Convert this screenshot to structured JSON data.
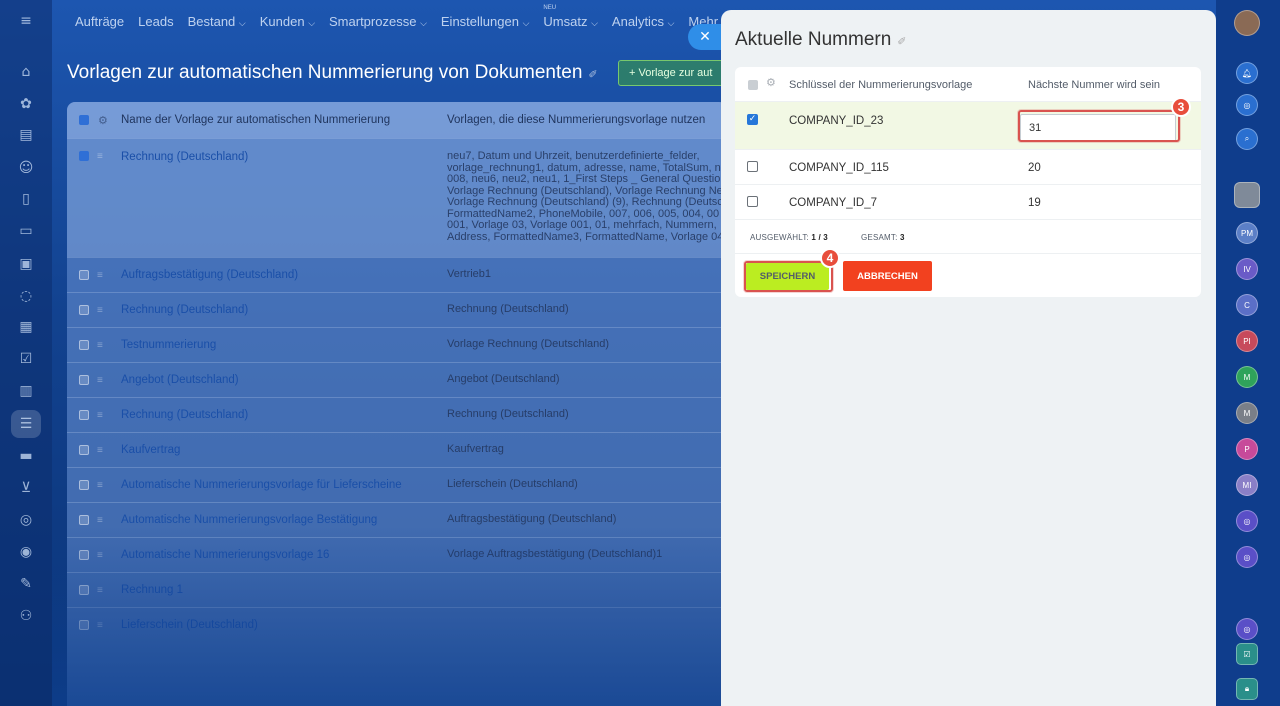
{
  "topnav": {
    "items": [
      "Aufträge",
      "Leads",
      "Bestand",
      "Kunden",
      "Smartprozesse",
      "Einstellungen",
      "Umsatz",
      "Analytics",
      "Mehr"
    ],
    "dropdown_marker": "⌵",
    "new_badge": "NEU"
  },
  "page": {
    "title": "Vorlagen zur automatischen Nummerierung von Dokumenten",
    "add_button": "+ Vorlage zur aut"
  },
  "bg_table": {
    "headers": [
      "Name der Vorlage zur automatischen Nummerierung",
      "Vorlagen, die diese Nummerierungsvorlage nutzen"
    ],
    "rows": [
      {
        "name": "Rechnung (Deutschland)",
        "templates": "neu7, Datum und Uhrzeit, benutzerdefinierte_felder,\nvorlage_rechnung1, datum, adresse, name, TotalSum, ne\n008, neu6, neu2, neu1, 1_First Steps _ General Questio\nVorlage Rechnung (Deutschland), Vorlage Rechnung Ne\nVorlage Rechnung (Deutschland) (9), Rechnung (Deutsc\nFormattedName2, PhoneMobile, 007, 006, 005, 004, 00\n001, Vorlage 03, Vorlage 001, 01, mehrfach, Nummern,\nAddress, FormattedName3, FormattedName, Vorlage 04"
      },
      {
        "name": "Auftragsbestätigung (Deutschland)",
        "templates": "Vertrieb1"
      },
      {
        "name": "Rechnung (Deutschland)",
        "templates": "Rechnung (Deutschland)"
      },
      {
        "name": "Testnummerierung",
        "templates": "Vorlage Rechnung (Deutschland)"
      },
      {
        "name": "Angebot (Deutschland)",
        "templates": "Angebot (Deutschland)"
      },
      {
        "name": "Rechnung (Deutschland)",
        "templates": "Rechnung (Deutschland)"
      },
      {
        "name": "Kaufvertrag",
        "templates": "Kaufvertrag"
      },
      {
        "name": "Automatische Nummerierungsvorlage für Lieferscheine",
        "templates": "Lieferschein (Deutschland)"
      },
      {
        "name": "Automatische Nummerierungsvorlage Bestätigung",
        "templates": "Auftragsbestätigung (Deutschland)"
      },
      {
        "name": "Automatische Nummerierungsvorlage 16",
        "templates": "Vorlage Auftragsbestätigung (Deutschland)1"
      },
      {
        "name": "Rechnung 1",
        "templates": ""
      },
      {
        "name": "Lieferschein (Deutschland)",
        "templates": ""
      }
    ]
  },
  "panel": {
    "close_glyph": "✕",
    "title": "Aktuelle Nummern",
    "col_key": "Schlüssel der Nummerierungsvorlage",
    "col_next": "Nächste Nummer wird sein",
    "rows": [
      {
        "key": "COMPANY_ID_23",
        "value": "31",
        "checked": true
      },
      {
        "key": "COMPANY_ID_115",
        "value": "20",
        "checked": false
      },
      {
        "key": "COMPANY_ID_7",
        "value": "19",
        "checked": false
      }
    ],
    "selected_label": "AUSGEWÄHLT:",
    "selected_value": "1 / 3",
    "total_label": "GESAMT:",
    "total_value": "3",
    "save_label": "SPEICHERN",
    "cancel_label": "ABBRECHEN",
    "badge_input": "3",
    "badge_save": "4"
  },
  "rightbar": {
    "avatars": [
      "PM",
      "IV",
      "C",
      "PI",
      "M",
      "M",
      "P",
      "MI"
    ]
  },
  "colors": {
    "accent": "#2f8ee8",
    "save": "#bbed21",
    "cancel": "#f2411f",
    "badge": "#e84e3c",
    "highlight_row": "#f2f8e4"
  }
}
